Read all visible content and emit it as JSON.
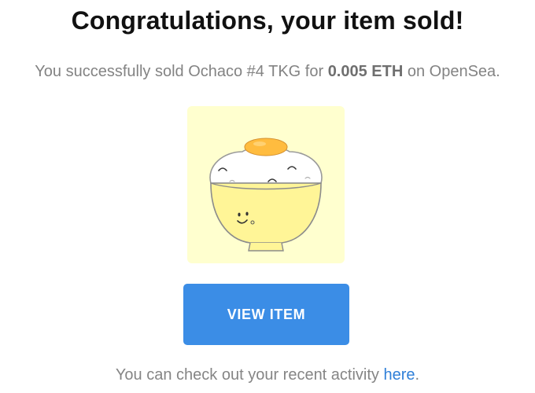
{
  "headline": "Congratulations, your item sold!",
  "sale_message": {
    "prefix": "You successfully sold ",
    "item_name": "Ochaco #4 TKG",
    "for_text": " for ",
    "price": "0.005 ETH",
    "suffix": " on OpenSea."
  },
  "nft_image": {
    "background_color": "#ffffcf",
    "bowl_color": "#fff597",
    "rice_color": "#ffffff",
    "yolk_color": "#ffbc3f"
  },
  "view_button": {
    "label": "VIEW ITEM",
    "color": "#3b8de6"
  },
  "footer": {
    "text": "You can check out your recent activity ",
    "link_text": "here",
    "end": "."
  }
}
